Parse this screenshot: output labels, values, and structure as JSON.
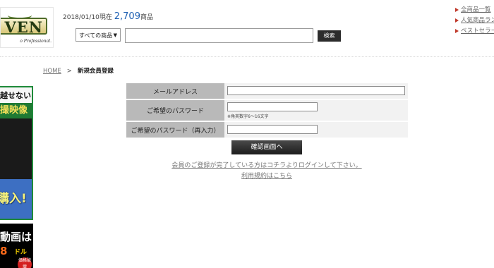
{
  "header": {
    "logo_text": "VEN",
    "logo_tagline": "o Professional.",
    "date_prefix": "2018/01/10現在",
    "product_count": "2,709",
    "count_suffix": "商品",
    "category_select": "すべての商品",
    "search_placeholder": "",
    "search_button": "検索",
    "top_links": [
      "全商品一覧",
      "人気商品ラン",
      "ベストセラー"
    ]
  },
  "left_banners": {
    "top_line1": "越せない",
    "top_line2": "撮映像",
    "top_buy": "購入!",
    "bottom_line1": "動画は",
    "bottom_line2": "8",
    "bottom_line3": "ドル",
    "bottom_badge": "価格破壊"
  },
  "breadcrumb": {
    "home": "HOME",
    "separator": ">",
    "current": "新規会員登録"
  },
  "form": {
    "email_label": "メールアドレス",
    "password_label": "ご希望のパスワード",
    "password_hint": "※角英数字6～16文字",
    "password_confirm_label": "ご希望のパスワード（再入力）",
    "confirm_button": "確認画面へ",
    "login_link": "会員のご登録が完了している方はコチラよりログインして下さい。",
    "terms_link": "利用規約はこちら"
  },
  "colors": {
    "label_bg": "#b9b9b9",
    "count_color": "#1d5fb2",
    "link_triangle": "#c0392b",
    "button_bg": "#2c2c2c"
  }
}
